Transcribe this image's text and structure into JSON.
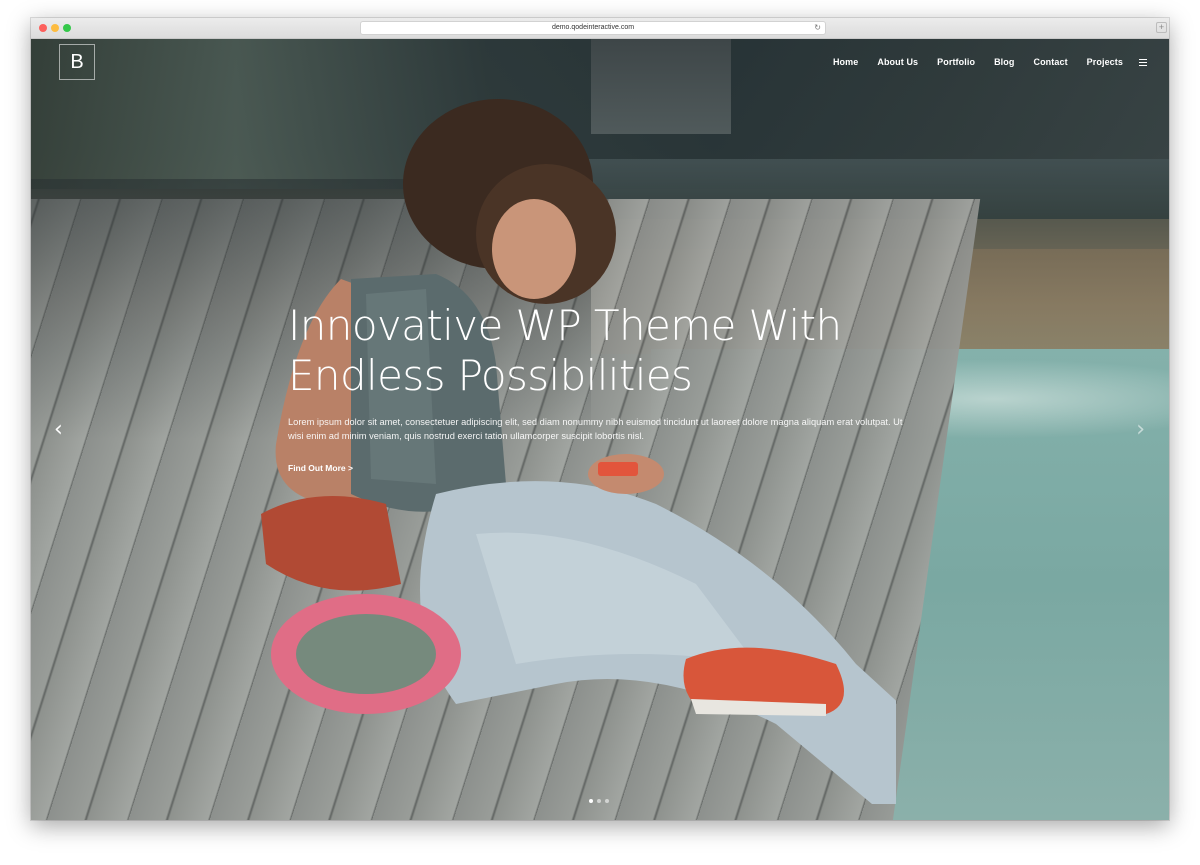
{
  "browser": {
    "url": "demo.qodeinteractive.com",
    "reload_icon": "reload-icon",
    "newtab_label": "+"
  },
  "site": {
    "logo_letter": "B"
  },
  "nav": {
    "items": [
      {
        "label": "Home"
      },
      {
        "label": "About Us"
      },
      {
        "label": "Portfolio"
      },
      {
        "label": "Blog"
      },
      {
        "label": "Contact"
      },
      {
        "label": "Projects"
      }
    ],
    "menu_icon": "hamburger-menu-icon"
  },
  "slider": {
    "title_line1": "Innovative WP Theme With",
    "title_line2": "Endless Possibilities",
    "description": "Lorem ipsum dolor sit amet, consectetuer adipiscing elit, sed diam nonummy nibh euismod tincidunt ut laoreet dolore magna aliquam erat volutpat. Ut wisi enim ad minim veniam, quis nostrud exerci tation ullamcorper suscipit lobortis nisl.",
    "cta_label": "Find Out More >",
    "prev_arrow": "‹",
    "next_arrow": "›",
    "slide_count": 3,
    "active_slide": 1
  },
  "colors": {
    "nav_text": "#ffffff",
    "traffic_close": "#fc605c",
    "traffic_min": "#fdbc40",
    "traffic_max": "#34c84a"
  }
}
